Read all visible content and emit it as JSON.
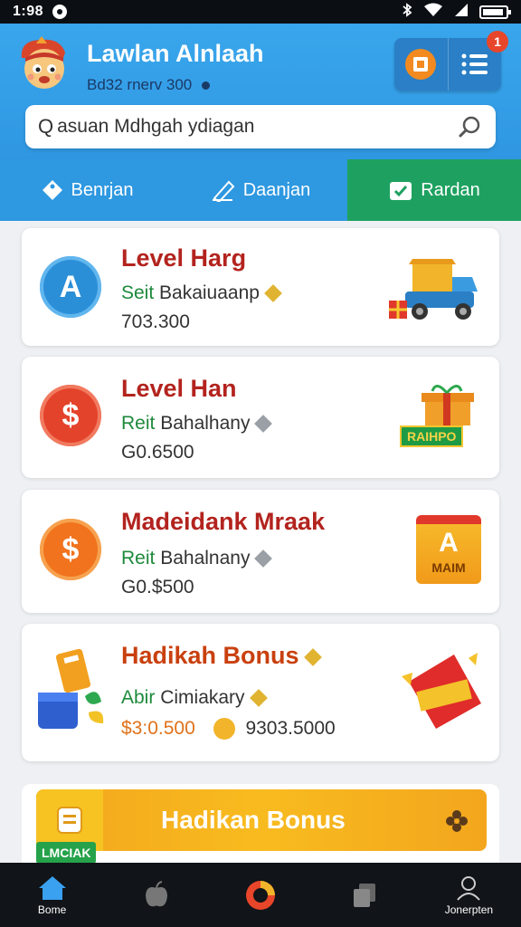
{
  "status_bar": {
    "time": "1:98"
  },
  "header": {
    "title": "Lawlan Alnlaah",
    "subtitle": "Bd32 rnerv 300",
    "notification_count": "1"
  },
  "search": {
    "placeholder": "asuan Mdhgah ydiagan"
  },
  "tabs": [
    {
      "label": "Benrjan",
      "active": false
    },
    {
      "label": "Daanjan",
      "active": false
    },
    {
      "label": "Rardan",
      "active": true
    }
  ],
  "cards": [
    {
      "icon_letter": "A",
      "title": "Level Harg",
      "sub_prefix": "Seit",
      "sub_text": "Bakaiuaanp",
      "value": "703.300"
    },
    {
      "icon_letter": "$",
      "title": "Level Han",
      "sub_prefix": "Reit",
      "sub_text": "Bahalhany",
      "value": "G0.6500",
      "image_label": "RAIHPO"
    },
    {
      "icon_letter": "$",
      "title": "Madeidank Mraak",
      "sub_prefix": "Reit",
      "sub_text": "Bahalnany",
      "value": "G0.$500",
      "image_letter": "A",
      "image_label": "MAIM"
    },
    {
      "title": "Hadikah Bonus",
      "sub_prefix": "Abir",
      "sub_text": "Cimiakary",
      "value": "$3:0.500",
      "value2": "9303.5000"
    }
  ],
  "promo": {
    "label": "Hadikan Bonus",
    "tag": "LMCIAK"
  },
  "bottom_nav": [
    {
      "label": "Bome",
      "icon": "home-icon"
    },
    {
      "label": "",
      "icon": "apple-icon"
    },
    {
      "label": "",
      "icon": "center-circle-icon"
    },
    {
      "label": "",
      "icon": "cards-icon"
    },
    {
      "label": "Jonerpten",
      "icon": "profile-icon"
    }
  ],
  "colors": {
    "header_blue": "#39a6ec",
    "tab_active_green": "#1ea160",
    "title_red": "#b3231e",
    "promo_orange": "#f8bb1f"
  }
}
